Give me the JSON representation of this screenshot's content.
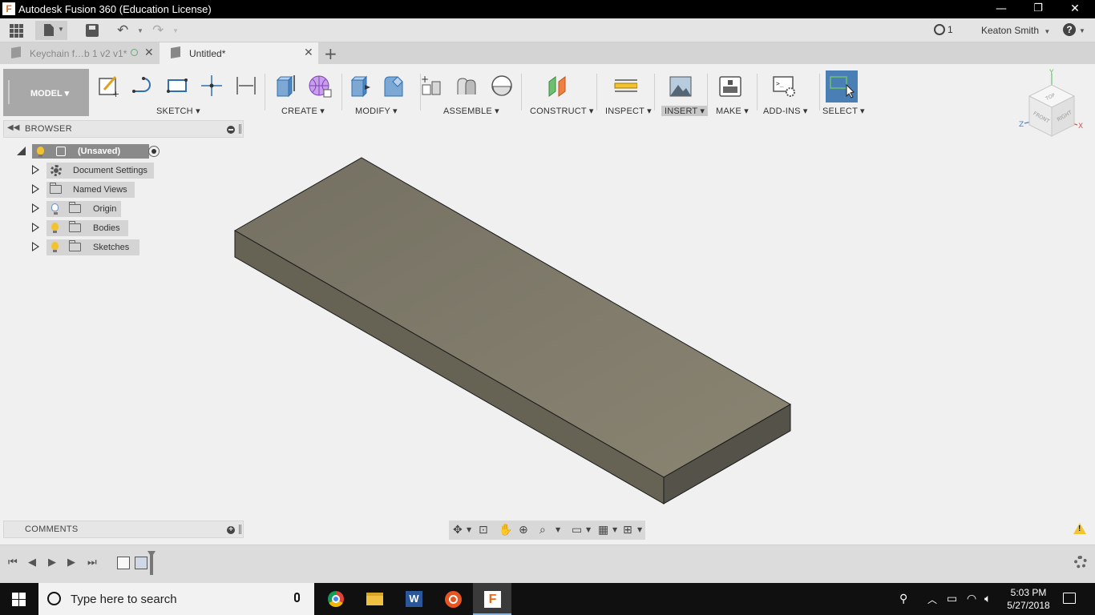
{
  "window": {
    "title": "Autodesk Fusion 360 (Education License)",
    "minimize": "—",
    "restore": "❐",
    "close": "✕"
  },
  "appbar": {
    "jobs_count": "1",
    "user": "Keaton Smith"
  },
  "tabs": [
    {
      "label": "Keychain f…b 1 v2 v1*",
      "active": false
    },
    {
      "label": "Untitled*",
      "active": true
    }
  ],
  "toolbar": {
    "workspace": "MODEL ▾",
    "groups": [
      {
        "label": "SKETCH ▾"
      },
      {
        "label": "CREATE ▾"
      },
      {
        "label": "MODIFY ▾"
      },
      {
        "label": "ASSEMBLE ▾"
      },
      {
        "label": "CONSTRUCT ▾"
      },
      {
        "label": "INSPECT ▾"
      },
      {
        "label": "INSERT ▾"
      },
      {
        "label": "MAKE ▾"
      },
      {
        "label": "ADD-INS ▾"
      },
      {
        "label": "SELECT ▾"
      }
    ]
  },
  "browser": {
    "title": "BROWSER",
    "root": "(Unsaved)",
    "items": [
      {
        "label": "Document Settings",
        "icon": "gear-icon"
      },
      {
        "label": "Named Views",
        "icon": "folder-icon"
      },
      {
        "label": "Origin",
        "icon": "folder-icon",
        "visibility": "hidden"
      },
      {
        "label": "Bodies",
        "icon": "folder-icon",
        "visibility": "visible"
      },
      {
        "label": "Sketches",
        "icon": "folder-icon",
        "visibility": "visible"
      }
    ]
  },
  "comments": {
    "title": "COMMENTS"
  },
  "viewcube": {
    "top": "TOP",
    "front": "FRONT",
    "right": "RIGHT",
    "x": "X",
    "y": "Y",
    "z": "Z"
  },
  "model": {
    "body_color": "#7d786a",
    "side_color": "#5e5a50"
  },
  "taskbar": {
    "search_placeholder": "Type here to search",
    "time": "5:03 PM",
    "date": "5/27/2018"
  }
}
